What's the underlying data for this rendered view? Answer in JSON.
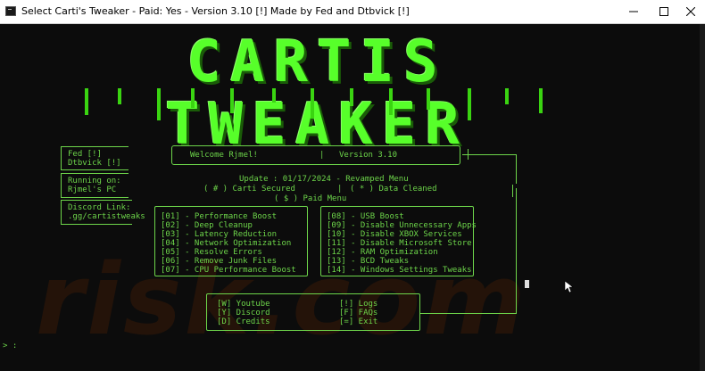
{
  "window": {
    "title": "Select Carti's Tweaker - Paid: Yes - Version 3.10 [!] Made by Fed and Dtbvick [!]",
    "controls": [
      "minimize",
      "maximize",
      "close"
    ]
  },
  "banner": {
    "text": "CARTIS TWEAKER"
  },
  "watermark": {
    "text": "risk.com"
  },
  "credits": {
    "line1": "Fed [!]",
    "line2": "Dtbvick [!]"
  },
  "running": {
    "label": "Running on:",
    "value": "Rjmel's PC"
  },
  "discord": {
    "label": "Discord Link:",
    "value": ".gg/cartistweaks"
  },
  "welcome": {
    "greeting": "Welcome Rjmel!",
    "version": "Version 3.10"
  },
  "status": {
    "update": "Update : 01/17/2024 - Revamped Menu",
    "secured": "( # ) Carti Secured",
    "divider": "|",
    "cleaned": "( * ) Data Cleaned",
    "paid_menu": "( $ ) Paid Menu"
  },
  "menu_left": [
    "[01] - Performance Boost",
    "[02] - Deep Cleanup",
    "[03] - Latency Reduction",
    "[04] - Network Optimization",
    "[05] - Resolve Errors",
    "[06] - Remove Junk Files",
    "[07] - CPU Performance Boost"
  ],
  "menu_right": [
    "[08] - USB Boost",
    "[09] - Disable Unnecessary Apps",
    "[10] - Disable XBOX Services",
    "[11] - Disable Microsoft Store",
    "[12] - RAM Optimization",
    "[13] - BCD Tweaks",
    "[14] - Windows Settings Tweaks"
  ],
  "bottom_left": [
    "[W] Youtube",
    "[Y] Discord",
    "[D] Credits"
  ],
  "bottom_right": [
    "[!] Logs",
    "[F] FAQs",
    "[=] Exit"
  ],
  "prompt": {
    "text": "> :"
  },
  "colors": {
    "accent": "#6dd54a",
    "banner": "#57ff2a",
    "background": "#0c0c0c"
  }
}
